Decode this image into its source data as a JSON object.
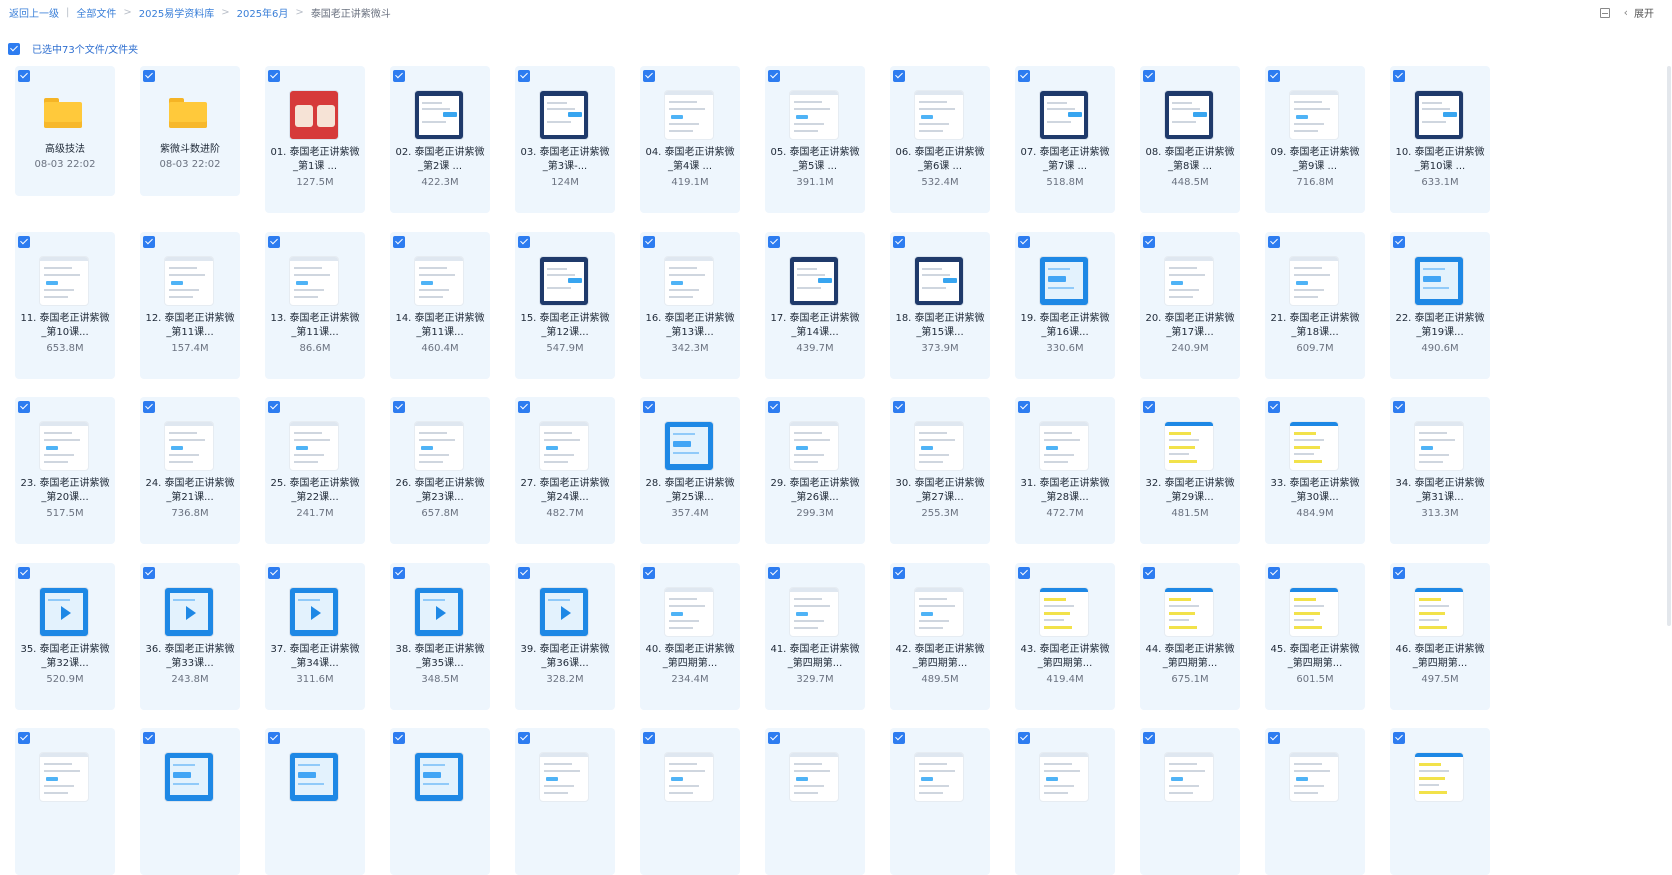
{
  "breadcrumb": {
    "back": "返回上一级",
    "items": [
      "全部文件",
      "2025易学资料库",
      "2025年6月"
    ],
    "current": "泰国老正讲紫微斗"
  },
  "top_right": {
    "expand_label": "展开"
  },
  "selection": {
    "label": "已选中73个文件/文件夹"
  },
  "colors": {
    "accent": "#2d7cf0",
    "card_bg": "#eef6fd",
    "folder": "#ffc93b"
  },
  "items": [
    {
      "kind": "folder",
      "name": "高级技法",
      "meta": "08-03 22:02"
    },
    {
      "kind": "folder",
      "name": "紫微斗数进阶",
      "meta": "08-03 22:02"
    },
    {
      "kind": "video",
      "thumb": "red",
      "name": "01. 泰国老正讲紫微_第1课 ...",
      "size": "127.5M"
    },
    {
      "kind": "video",
      "thumb": "dark",
      "name": "02. 泰国老正讲紫微_第2课 ...",
      "size": "422.3M"
    },
    {
      "kind": "video",
      "thumb": "dark",
      "name": "03. 泰国老正讲紫微_第3课-...",
      "size": "124M"
    },
    {
      "kind": "video",
      "thumb": "white",
      "name": "04. 泰国老正讲紫微_第4课 ...",
      "size": "419.1M"
    },
    {
      "kind": "video",
      "thumb": "white",
      "name": "05. 泰国老正讲紫微_第5课 ...",
      "size": "391.1M"
    },
    {
      "kind": "video",
      "thumb": "white",
      "name": "06. 泰国老正讲紫微_第6课 ...",
      "size": "532.4M"
    },
    {
      "kind": "video",
      "thumb": "dark",
      "name": "07. 泰国老正讲紫微_第7课 ...",
      "size": "518.8M"
    },
    {
      "kind": "video",
      "thumb": "dark",
      "name": "08. 泰国老正讲紫微_第8课 ...",
      "size": "448.5M"
    },
    {
      "kind": "video",
      "thumb": "white",
      "name": "09. 泰国老正讲紫微_第9课 ...",
      "size": "716.8M"
    },
    {
      "kind": "video",
      "thumb": "dark",
      "name": "10. 泰国老正讲紫微_第10课 ...",
      "size": "633.1M"
    },
    {
      "kind": "video",
      "thumb": "white",
      "name": "11. 泰国老正讲紫微_第10课...",
      "size": "653.8M"
    },
    {
      "kind": "video",
      "thumb": "white",
      "name": "12. 泰国老正讲紫微_第11课...",
      "size": "157.4M"
    },
    {
      "kind": "video",
      "thumb": "white",
      "name": "13. 泰国老正讲紫微_第11课...",
      "size": "86.6M"
    },
    {
      "kind": "video",
      "thumb": "white",
      "name": "14. 泰国老正讲紫微_第11课...",
      "size": "460.4M"
    },
    {
      "kind": "video",
      "thumb": "dark",
      "name": "15. 泰国老正讲紫微_第12课...",
      "size": "547.9M"
    },
    {
      "kind": "video",
      "thumb": "white",
      "name": "16. 泰国老正讲紫微_第13课...",
      "size": "342.3M"
    },
    {
      "kind": "video",
      "thumb": "dark",
      "name": "17. 泰国老正讲紫微_第14课...",
      "size": "439.7M"
    },
    {
      "kind": "video",
      "thumb": "dark",
      "name": "18. 泰国老正讲紫微_第15课...",
      "size": "373.9M"
    },
    {
      "kind": "video",
      "thumb": "blue",
      "name": "19. 泰国老正讲紫微_第16课...",
      "size": "330.6M"
    },
    {
      "kind": "video",
      "thumb": "white",
      "name": "20. 泰国老正讲紫微_第17课...",
      "size": "240.9M"
    },
    {
      "kind": "video",
      "thumb": "white",
      "name": "21. 泰国老正讲紫微_第18课...",
      "size": "609.7M"
    },
    {
      "kind": "video",
      "thumb": "blue",
      "name": "22. 泰国老正讲紫微_第19课...",
      "size": "490.6M"
    },
    {
      "kind": "video",
      "thumb": "white",
      "name": "23. 泰国老正讲紫微_第20课...",
      "size": "517.5M"
    },
    {
      "kind": "video",
      "thumb": "white",
      "name": "24. 泰国老正讲紫微_第21课...",
      "size": "736.8M"
    },
    {
      "kind": "video",
      "thumb": "white",
      "name": "25. 泰国老正讲紫微_第22课...",
      "size": "241.7M"
    },
    {
      "kind": "video",
      "thumb": "white",
      "name": "26. 泰国老正讲紫微_第23课...",
      "size": "657.8M"
    },
    {
      "kind": "video",
      "thumb": "white",
      "name": "27. 泰国老正讲紫微_第24课...",
      "size": "482.7M"
    },
    {
      "kind": "video",
      "thumb": "blue",
      "name": "28. 泰国老正讲紫微_第25课...",
      "size": "357.4M"
    },
    {
      "kind": "video",
      "thumb": "white",
      "name": "29. 泰国老正讲紫微_第26课...",
      "size": "299.3M"
    },
    {
      "kind": "video",
      "thumb": "white",
      "name": "30. 泰国老正讲紫微_第27课...",
      "size": "255.3M"
    },
    {
      "kind": "video",
      "thumb": "white",
      "name": "31. 泰国老正讲紫微_第28课...",
      "size": "472.7M"
    },
    {
      "kind": "video",
      "thumb": "yellow",
      "name": "32. 泰国老正讲紫微_第29课...",
      "size": "481.5M"
    },
    {
      "kind": "video",
      "thumb": "yellow",
      "name": "33. 泰国老正讲紫微_第30课...",
      "size": "484.9M"
    },
    {
      "kind": "video",
      "thumb": "white",
      "name": "34. 泰国老正讲紫微_第31课...",
      "size": "313.3M"
    },
    {
      "kind": "video",
      "thumb": "blueplay",
      "name": "35. 泰国老正讲紫微_第32课...",
      "size": "520.9M"
    },
    {
      "kind": "video",
      "thumb": "blueplay",
      "name": "36. 泰国老正讲紫微_第33课...",
      "size": "243.8M"
    },
    {
      "kind": "video",
      "thumb": "blueplay",
      "name": "37. 泰国老正讲紫微_第34课...",
      "size": "311.6M"
    },
    {
      "kind": "video",
      "thumb": "blueplay",
      "name": "38. 泰国老正讲紫微_第35课...",
      "size": "348.5M"
    },
    {
      "kind": "video",
      "thumb": "blueplay",
      "name": "39. 泰国老正讲紫微_第36课...",
      "size": "328.2M"
    },
    {
      "kind": "video",
      "thumb": "white",
      "name": "40. 泰国老正讲紫微_第四期第...",
      "size": "234.4M"
    },
    {
      "kind": "video",
      "thumb": "white",
      "name": "41. 泰国老正讲紫微_第四期第...",
      "size": "329.7M"
    },
    {
      "kind": "video",
      "thumb": "white",
      "name": "42. 泰国老正讲紫微_第四期第...",
      "size": "489.5M"
    },
    {
      "kind": "video",
      "thumb": "yellow",
      "name": "43. 泰国老正讲紫微_第四期第...",
      "size": "419.4M"
    },
    {
      "kind": "video",
      "thumb": "yellow",
      "name": "44. 泰国老正讲紫微_第四期第...",
      "size": "675.1M"
    },
    {
      "kind": "video",
      "thumb": "yellow",
      "name": "45. 泰国老正讲紫微_第四期第...",
      "size": "601.5M"
    },
    {
      "kind": "video",
      "thumb": "yellow",
      "name": "46. 泰国老正讲紫微_第四期第...",
      "size": "497.5M"
    },
    {
      "kind": "video",
      "thumb": "white",
      "name": "",
      "size": ""
    },
    {
      "kind": "video",
      "thumb": "blue",
      "name": "",
      "size": ""
    },
    {
      "kind": "video",
      "thumb": "blue",
      "name": "",
      "size": ""
    },
    {
      "kind": "video",
      "thumb": "blue",
      "name": "",
      "size": ""
    },
    {
      "kind": "video",
      "thumb": "white",
      "name": "",
      "size": ""
    },
    {
      "kind": "video",
      "thumb": "white",
      "name": "",
      "size": ""
    },
    {
      "kind": "video",
      "thumb": "white",
      "name": "",
      "size": ""
    },
    {
      "kind": "video",
      "thumb": "white",
      "name": "",
      "size": ""
    },
    {
      "kind": "video",
      "thumb": "white",
      "name": "",
      "size": ""
    },
    {
      "kind": "video",
      "thumb": "white",
      "name": "",
      "size": ""
    },
    {
      "kind": "video",
      "thumb": "white",
      "name": "",
      "size": ""
    },
    {
      "kind": "video",
      "thumb": "yellow",
      "name": "",
      "size": ""
    }
  ]
}
